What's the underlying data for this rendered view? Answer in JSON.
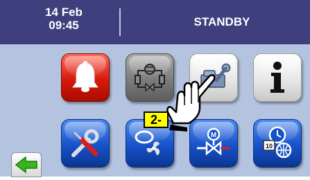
{
  "header": {
    "date": "14 Feb",
    "time": "09:45",
    "status": "STANDBY"
  },
  "buttons": [
    {
      "name": "alarm",
      "icon": "bell-icon",
      "color": "#d7190c"
    },
    {
      "name": "circuit",
      "icon": "refrigeration-circuit-icon",
      "color": "#7c7c7c"
    },
    {
      "name": "service",
      "icon": "service-tools-icon",
      "color": "#e7e7e7"
    },
    {
      "name": "info",
      "icon": "info-icon",
      "color": "#e7e7e7"
    },
    {
      "name": "settings",
      "icon": "screwdriver-wrench-icon",
      "color": "#1652c9"
    },
    {
      "name": "fans",
      "icon": "compressor-fan-icon",
      "color": "#1652c9"
    },
    {
      "name": "valve",
      "icon": "motor-valve-icon",
      "color": "#1652c9"
    },
    {
      "name": "clock-network",
      "icon": "clock-network-icon",
      "color": "#1652c9"
    }
  ],
  "nav": {
    "back_icon": "green-left-arrow-icon"
  },
  "annotation": {
    "step_label": "2-",
    "pointer_icon": "pointing-hand-icon"
  }
}
